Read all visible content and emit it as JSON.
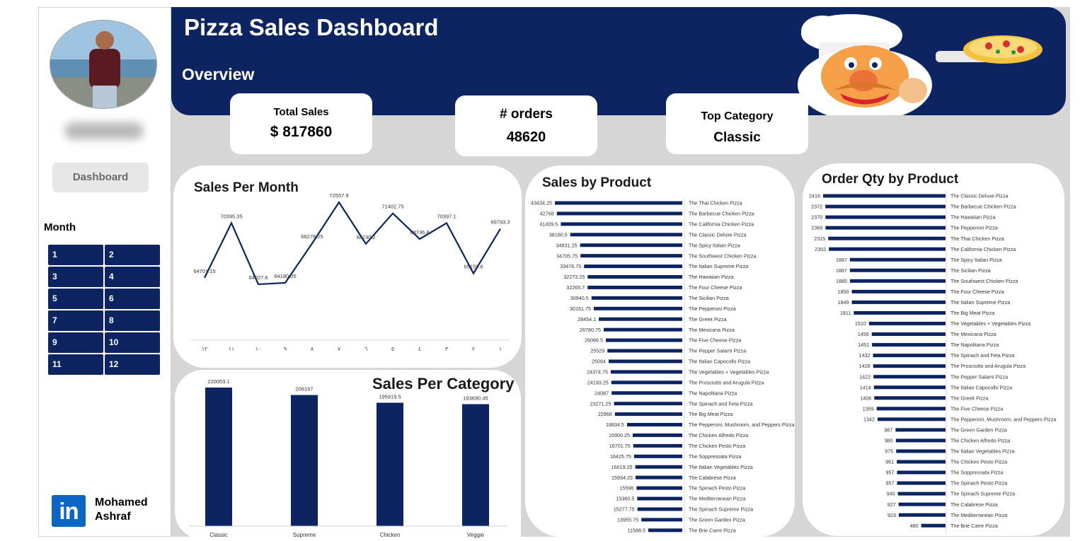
{
  "header": {
    "title": "Pizza Sales Dashboard",
    "subtitle": "Overview",
    "accent_color": "#0c2461"
  },
  "kpis": {
    "total_sales_label": "Total Sales",
    "total_sales_value": "$ 817860",
    "orders_label": "# orders",
    "orders_value": "48620",
    "top_category_label": "Top Category",
    "top_category_value": "Classic"
  },
  "sidebar": {
    "dashboard_label": "Dashboard",
    "month_label": "Month",
    "months": [
      "1",
      "2",
      "3",
      "4",
      "5",
      "6",
      "7",
      "8",
      "9",
      "10",
      "11",
      "12"
    ],
    "author_first": "Mohamed",
    "author_last": "Ashraf",
    "linkedin_text": "in"
  },
  "chart_data": [
    {
      "type": "line",
      "title": "Sales Per Month",
      "x": [
        "١٢",
        "١١",
        "١٠",
        "٩",
        "٨",
        "٧",
        "٦",
        "٥",
        "٤",
        "٣",
        "٢",
        "١"
      ],
      "series": [
        {
          "values": [
            64701.15,
            70395.35,
            64027.6,
            64180.05,
            68278.25,
            72557.9,
            68230.2,
            71402.75,
            68736.8,
            70397.1,
            65159.6,
            69793.3
          ]
        }
      ],
      "value_labels": [
        "64701.15",
        "70395.35",
        "64027.6",
        "64180.05",
        "68278.25",
        "72557.9",
        "68230.2",
        "71402.75",
        "68736.8",
        "70397.1",
        "65159.6",
        "69793.3"
      ],
      "color": "#0c2461"
    },
    {
      "type": "bar",
      "title": "Sales Per Category",
      "categories": [
        "Classic",
        "Supreme",
        "Chicken",
        "Veggie"
      ],
      "values": [
        220053.1,
        208197,
        195919.5,
        193690.45
      ],
      "value_labels": [
        "220053.1",
        "208197",
        "195919.5",
        "193690.45"
      ],
      "color": "#0c2461"
    },
    {
      "type": "bar",
      "orientation": "horizontal",
      "title": "Sales by Product",
      "categories": [
        "The Thai Chicken Pizza",
        "The Barbecue Chicken Pizza",
        "The California Chicken Pizza",
        "The Classic Deluxe Pizza",
        "The Spicy Italian Pizza",
        "The Southwest Chicken Pizza",
        "The Italian Supreme Pizza",
        "The Hawaiian Pizza",
        "The Four Cheese Pizza",
        "The Sicilian Pizza",
        "The Pepperoni Pizza",
        "The Greek Pizza",
        "The Mexicana Pizza",
        "The Five Cheese Pizza",
        "The Pepper Salami Pizza",
        "The Italian Capocollo Pizza",
        "The Vegetables + Vegetables Pizza",
        "The Prosciutto and Arugula Pizza",
        "The Napolitana Pizza",
        "The Spinach and Feta Pizza",
        "The Big Meat Pizza",
        "The Pepperoni, Mushroom, and Peppers Pizza",
        "The Chicken Alfredo Pizza",
        "The Chicken Pesto Pizza",
        "The Soppressata Pizza",
        "The Italian Vegetables Pizza",
        "The Calabrese Pizza",
        "The Spinach Pesto Pizza",
        "The Mediterranean Pizza",
        "The Spinach Supreme Pizza",
        "The Green Garden Pizza",
        "The Brie Carre Pizza"
      ],
      "values": [
        43434.25,
        42768,
        41409.5,
        38180.5,
        34831.25,
        34705.75,
        33476.75,
        32273.25,
        32265.7,
        30940.5,
        30161.75,
        28454.1,
        26780.75,
        26066.5,
        25529,
        25094,
        24374.75,
        24193.25,
        24087,
        23271.25,
        22968,
        18834.5,
        16900.25,
        16701.75,
        16425.75,
        16019.25,
        15934.25,
        15596,
        15360.5,
        15277.75,
        13955.75,
        11588.5
      ],
      "value_labels": [
        "43434.25",
        "42768",
        "41409.5",
        "38180.5",
        "34831.25",
        "34705.75",
        "33476.75",
        "32273.25",
        "32265.7",
        "30940.5",
        "30161.75",
        "28454.1",
        "26780.75",
        "26066.5",
        "25529",
        "25094",
        "24374.75",
        "24193.25",
        "24087",
        "23271.25",
        "22968",
        "18834.5",
        "16900.25",
        "16701.75",
        "16425.75",
        "16019.25",
        "15934.25",
        "15596",
        "15360.5",
        "15277.75",
        "13955.75",
        "11588.5"
      ],
      "color": "#0c2461"
    },
    {
      "type": "bar",
      "orientation": "horizontal",
      "title": "Order Qty by Product",
      "categories": [
        "The Classic Deluxe Pizza",
        "The Barbecue Chicken Pizza",
        "The Hawaiian Pizza",
        "The Pepperoni Pizza",
        "The Thai Chicken Pizza",
        "The California Chicken Pizza",
        "The Spicy Italian Pizza",
        "The Sicilian Pizza",
        "The Southwest Chicken Pizza",
        "The Four Cheese Pizza",
        "The Italian Supreme Pizza",
        "The Big Meat Pizza",
        "The Vegetables + Vegetables Pizza",
        "The Mexicana Pizza",
        "The Napolitana Pizza",
        "The Spinach and Feta Pizza",
        "The Prosciutto and Arugula Pizza",
        "The Pepper Salami Pizza",
        "The Italian Capocollo Pizza",
        "The Greek Pizza",
        "The Five Cheese Pizza",
        "The Pepperoni, Mushroom, and Peppers Pizza",
        "The Green Garden Pizza",
        "The Chicken Alfredo Pizza",
        "The Italian Vegetables Pizza",
        "The Chicken Pesto Pizza",
        "The Soppressata Pizza",
        "The Spinach Pesto Pizza",
        "The Spinach Supreme Pizza",
        "The Calabrese Pizza",
        "The Mediterranean Pizza",
        "The Brie Carre Pizza"
      ],
      "values": [
        2416,
        2372,
        2370,
        2369,
        2315,
        2302,
        1887,
        1887,
        1885,
        1850,
        1849,
        1811,
        1510,
        1456,
        1451,
        1432,
        1428,
        1422,
        1414,
        1406,
        1359,
        1342,
        987,
        980,
        975,
        961,
        957,
        957,
        940,
        927,
        923,
        480
      ],
      "value_labels": [
        "2416",
        "2372",
        "2370",
        "2369",
        "2315",
        "2302",
        "1887",
        "1887",
        "1885",
        "1850",
        "1849",
        "1811",
        "1510",
        "1456",
        "1451",
        "1432",
        "1428",
        "1422",
        "1414",
        "1406",
        "1359",
        "1342",
        "987",
        "980",
        "975",
        "961",
        "957",
        "957",
        "940",
        "927",
        "923",
        "480"
      ],
      "color": "#0c2461"
    }
  ]
}
